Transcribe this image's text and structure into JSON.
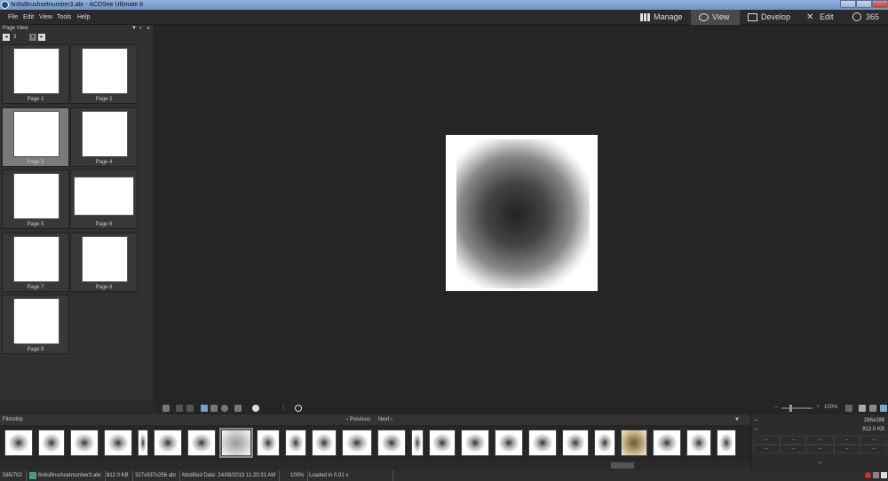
{
  "window": {
    "title": "6n6sBrushsetnumber3.abr - ACDSee Ultimate 8"
  },
  "menu": [
    "File",
    "Edit",
    "View",
    "Tools",
    "Help"
  ],
  "modes": [
    {
      "label": "Manage",
      "icon": "grid-icon"
    },
    {
      "label": "View",
      "icon": "eye-icon",
      "active": true
    },
    {
      "label": "Develop",
      "icon": "photo-icon"
    },
    {
      "label": "Edit",
      "icon": "tools-icon"
    },
    {
      "label": "365",
      "icon": "cloud-365-icon"
    }
  ],
  "page_view": {
    "title": "Page View",
    "current_page": "3",
    "pages": [
      "Page 1",
      "Page 2",
      "Page 3",
      "Page 4",
      "Page 5",
      "Page 6",
      "Page 7",
      "Page 8",
      "Page 9"
    ],
    "selected": "Page 3"
  },
  "filmstrip": {
    "title": "Filmstrip",
    "previous": "Previous",
    "next": "Next",
    "count": 24
  },
  "zoom": {
    "value": "100%"
  },
  "info_panel": {
    "row1_left": "--",
    "row1_right": "286x288",
    "row2_left": "--",
    "row2_right": "812.0 KB",
    "grid": [
      "--",
      "--",
      "--",
      "--",
      "--",
      "--",
      "--",
      "--",
      "--",
      "--"
    ],
    "footer": "--"
  },
  "status": {
    "index": "585/702",
    "filename": "6n6sBrushsetnumber3.abr",
    "size": "812.0 KB",
    "dimensions": "327x337x256 abr",
    "modified": "Modified Date: 24/08/2013 11:20:31 AM",
    "zoom": "100%",
    "loaded": "Loaded in 0.01 s"
  }
}
